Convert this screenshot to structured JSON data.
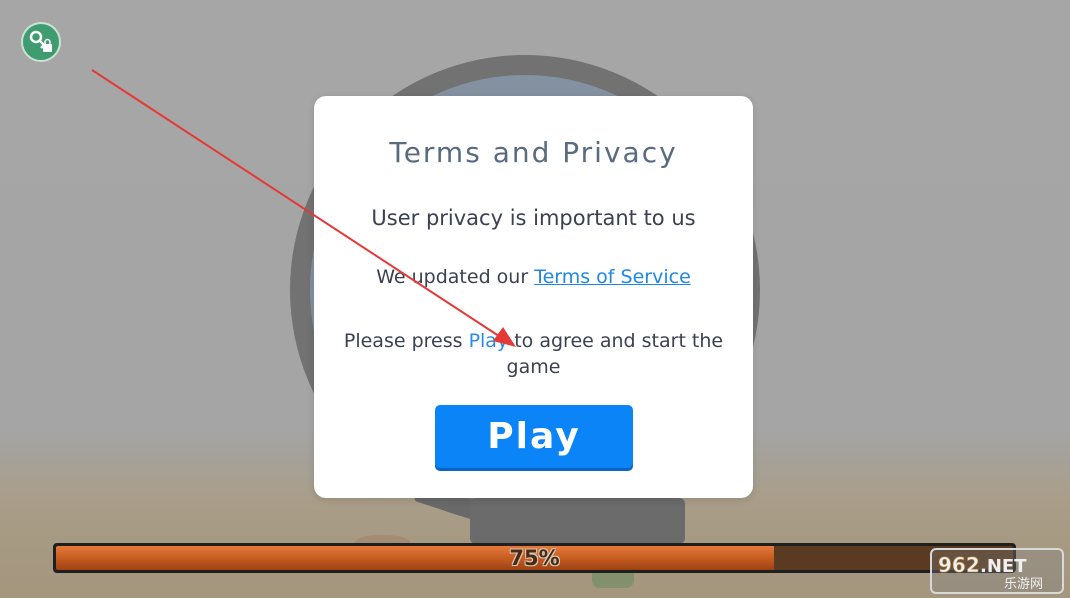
{
  "dialog": {
    "title": "Terms and Privacy",
    "privacy_text": "User privacy is important to us",
    "terms_prefix": "We updated our ",
    "terms_link": "Terms of Service",
    "press_prefix": "Please press ",
    "press_play_word": "Play",
    "press_suffix": " to agree and start the game",
    "play_button": "Play"
  },
  "loading": {
    "progress_text": "75%",
    "progress_value": 0.75
  },
  "watermark": {
    "text": "962.NET 乐游网"
  },
  "icons": {
    "top_left": "key-lock-icon"
  },
  "colors": {
    "play_button": "#0b84f7",
    "link": "#1e88e5",
    "progress_fill": "#c65d21",
    "annotation_arrow": "#e53935"
  }
}
